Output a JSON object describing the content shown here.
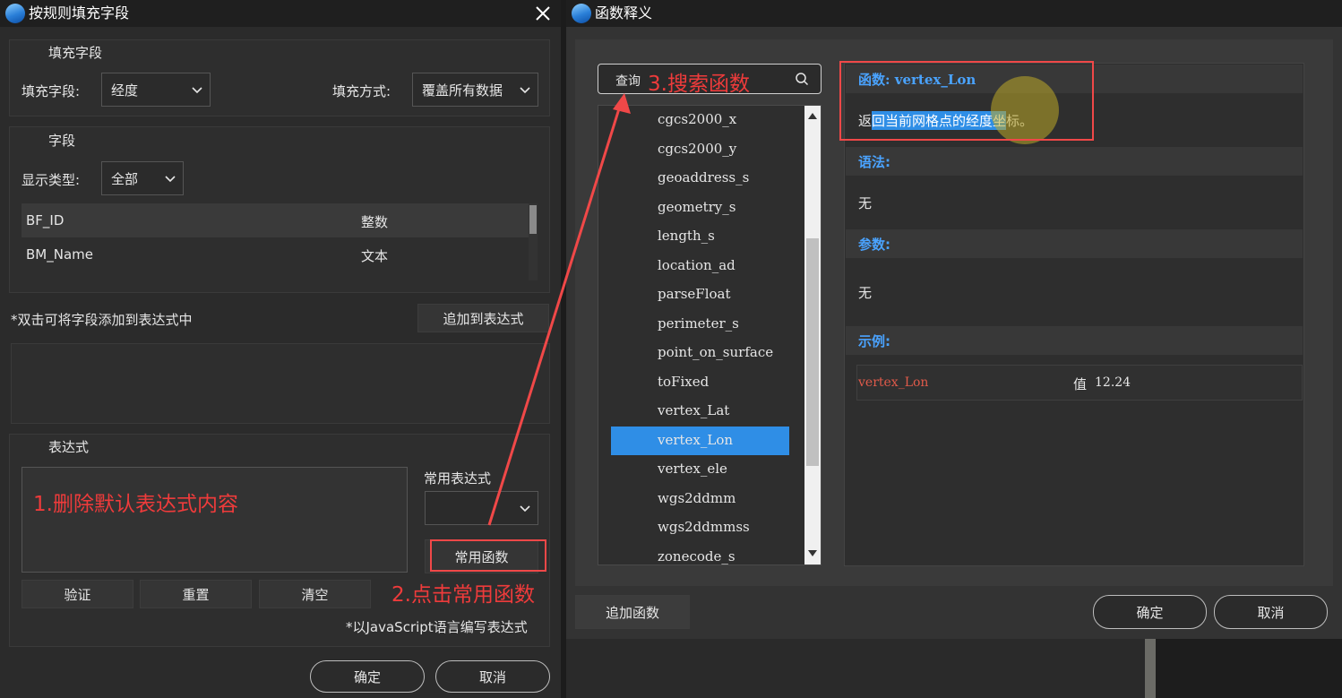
{
  "left": {
    "title": "按规则填充字段",
    "fill_group": {
      "legend": "填充字段",
      "field_label": "填充字段:",
      "field_value": "经度",
      "mode_label": "填充方式:",
      "mode_value": "覆盖所有数据"
    },
    "field_group": {
      "legend": "字段",
      "type_label": "显示类型:",
      "type_value": "全部",
      "rows": [
        {
          "name": "BF_ID",
          "type": "整数"
        },
        {
          "name": "BM_Name",
          "type": "文本"
        }
      ]
    },
    "hint": "*双击可将字段添加到表达式中",
    "append_btn": "追加到表达式",
    "expr_group": {
      "legend": "表达式",
      "common_expr_label": "常用表达式",
      "common_func_btn": "常用函数",
      "verify_btn": "验证",
      "reset_btn": "重置",
      "clear_btn": "清空",
      "js_note": "*以JavaScript语言编写表达式"
    },
    "ok_btn": "确定",
    "cancel_btn": "取消",
    "annotation1": "1.删除默认表达式内容",
    "annotation2": "2.点击常用函数"
  },
  "right": {
    "title": "函数释义",
    "search_label": "查询",
    "annotation3": "3.搜索函数",
    "functions": [
      "cgcs2000_x",
      "cgcs2000_y",
      "geoaddress_s",
      "geometry_s",
      "length_s",
      "location_ad",
      "parseFloat",
      "perimeter_s",
      "point_on_surface",
      "toFixed",
      "vertex_Lat",
      "vertex_Lon",
      "vertex_ele",
      "wgs2ddmm",
      "wgs2ddmmss",
      "zonecode_s"
    ],
    "selected_function": "vertex_Lon",
    "func_title": "函数: vertex_Lon",
    "desc_start": "返",
    "desc_highlight": "回当前网格点的经度坐",
    "desc_end": "标。",
    "syntax_label": "语法:",
    "syntax_value": "无",
    "params_label": "参数:",
    "params_value": "无",
    "example_label": "示例:",
    "example_expr": "vertex_Lon",
    "example_value_label": "值",
    "example_value": "12.24",
    "add_func_btn": "追加函数",
    "ok_btn": "确定",
    "cancel_btn": "取消"
  },
  "colors": {
    "accent_blue": "#4aa3ff",
    "selection_blue": "#2f8ee6",
    "annotation_red": "#ee3b3b",
    "example_red": "#e05a4a"
  }
}
